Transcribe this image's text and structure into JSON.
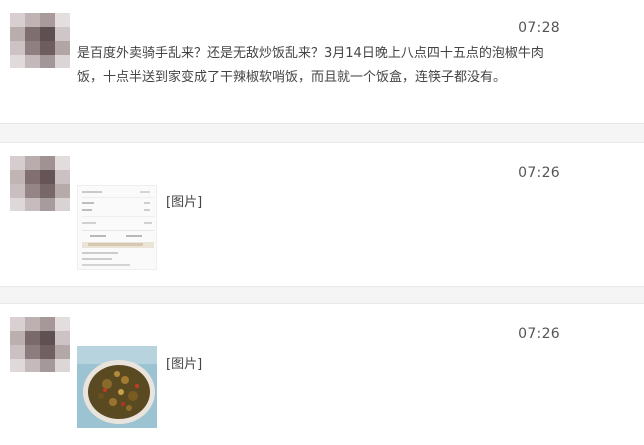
{
  "messages": [
    {
      "time": "07:28",
      "text": "是百度外卖骑手乱来？还是无敌炒饭乱来？3月14日晚上八点四十五点的泡椒牛肉饭，十点半送到家变成了干辣椒软哨饭，而且就一个饭盒，连筷子都没有。"
    },
    {
      "time": "07:26",
      "image_label": "[图片]",
      "thumbnail": "delivery-receipt-screenshot"
    },
    {
      "time": "07:26",
      "image_label": "[图片]",
      "thumbnail": "food-bowl-photo"
    }
  ],
  "colors": {
    "background": "#ffffff",
    "separator": "#f5f5f5",
    "time_text": "#555555",
    "body_text": "#444444"
  }
}
